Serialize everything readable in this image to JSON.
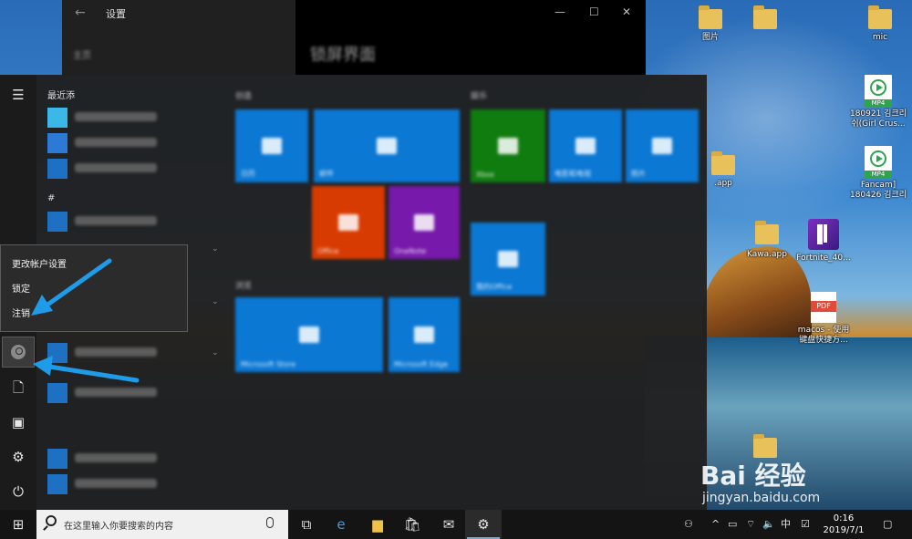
{
  "settings_window": {
    "title": "设置",
    "page_title": "锁屏界面",
    "sub": "主页",
    "back_glyph": "←",
    "minimize_glyph": "—",
    "maximize_glyph": "☐",
    "close_glyph": "✕"
  },
  "start_menu": {
    "recent_label": "最近添",
    "hash_label": "#",
    "groups": [
      {
        "label": "创造"
      },
      {
        "label": "娱乐"
      },
      {
        "label": "浏览"
      }
    ],
    "tiles": [
      {
        "name": "日历",
        "color": "#0b78d4"
      },
      {
        "name": "邮件",
        "color": "#0b78d4"
      },
      {
        "name": "Office",
        "color": "#d83b01"
      },
      {
        "name": "OneNote",
        "color": "#7719aa"
      },
      {
        "name": "Xbox",
        "color": "#107c10"
      },
      {
        "name": "电影和电视",
        "color": "#0b78d4"
      },
      {
        "name": "照片",
        "color": "#0b78d4"
      },
      {
        "name": "我的Office",
        "color": "#0b78d4"
      },
      {
        "name": "Microsoft Store",
        "color": "#0b78d4"
      },
      {
        "name": "Microsoft Edge",
        "color": "#0b78d4"
      }
    ]
  },
  "context_menu": {
    "items": [
      "更改帐户设置",
      "锁定",
      "注销"
    ]
  },
  "desktop": {
    "icons": [
      {
        "label": "图片",
        "kind": "folder"
      },
      {
        "label": "",
        "kind": "folder"
      },
      {
        "label": "mic",
        "kind": "folder"
      },
      {
        "label": "180921 김크리\n쉬(Girl Crus...",
        "kind": "mp4",
        "tag": "MP4"
      },
      {
        "label": "Fancam]\n180426 김크리",
        "kind": "mp4",
        "tag": "MP4"
      },
      {
        "label": ".app",
        "kind": "folder"
      },
      {
        "label": "Kawa.app",
        "kind": "folder"
      },
      {
        "label": "Fortnite_40...",
        "kind": "fortnite"
      },
      {
        "label": "macos - 使用\n键盘快捷方...",
        "kind": "pdf",
        "tag": "PDF"
      },
      {
        "label": "",
        "kind": "folder"
      }
    ]
  },
  "taskbar": {
    "search_placeholder": "在这里输入你要搜索的内容",
    "ime": "中",
    "time": "0:16",
    "date": "2019/7/1"
  },
  "watermark": {
    "logo": "Bai 经验",
    "url": "jingyan.baidu.com"
  },
  "colors": {
    "accent": "#0b78d4",
    "annotation_arrow": "#1e9be9",
    "menu_bg": "#2b2b2b",
    "taskbar_bg": "#141414"
  }
}
